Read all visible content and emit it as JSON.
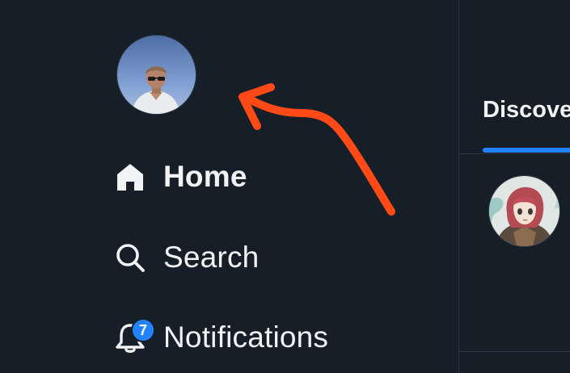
{
  "profile": {
    "avatar_icon": "user-photo-avatar"
  },
  "nav": {
    "items": [
      {
        "label": "Home",
        "icon": "home-icon",
        "active": true
      },
      {
        "label": "Search",
        "icon": "search-icon",
        "active": false
      },
      {
        "label": "Notifications",
        "icon": "bell-icon",
        "active": false,
        "badge": "7"
      }
    ]
  },
  "feed": {
    "tabs": [
      {
        "label": "Discover",
        "active": true
      }
    ],
    "posts": [
      {
        "avatar_icon": "anime-character-avatar"
      }
    ]
  },
  "annotation": {
    "type": "arrow",
    "color": "#ff4a17",
    "points_to": "profile-avatar"
  },
  "colors": {
    "background": "#161e27",
    "text": "#f1f3f5",
    "accent": "#2383ff",
    "divider": "#2a3541"
  }
}
